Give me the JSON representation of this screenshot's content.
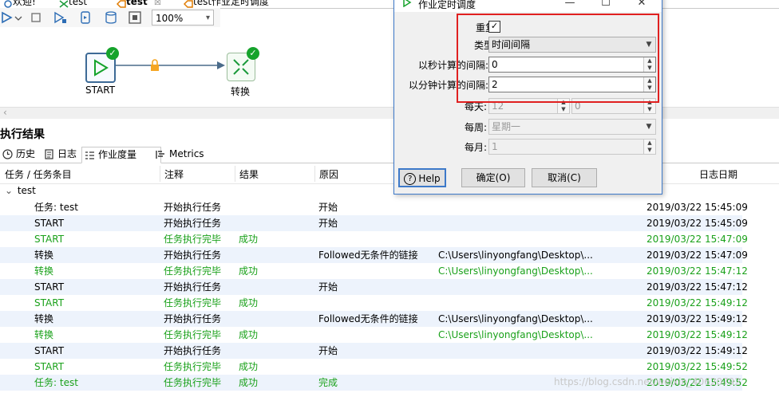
{
  "tabs": [
    {
      "label": "欢迎!",
      "active": false
    },
    {
      "label": "test",
      "active": false
    },
    {
      "label": "test",
      "active": true,
      "close": "☒"
    },
    {
      "label": "test作业定时调度",
      "active": false
    }
  ],
  "toolbar": {
    "zoom": "100%"
  },
  "canvas": {
    "start_label": "START",
    "transform_label": "转换"
  },
  "results": {
    "title": "执行结果",
    "subtabs": [
      "历史",
      "日志",
      "作业度量",
      "Metrics"
    ],
    "columns": {
      "task": "任务 / 任务条目",
      "comment": "注释",
      "result": "结果",
      "reason": "原因",
      "date": "日志日期"
    },
    "group": "test",
    "rows": [
      {
        "task": "任务: test",
        "comment": "开始执行任务",
        "result": "",
        "reason": "开始",
        "file": "",
        "date": "2019/03/22 15:45:09",
        "green": false
      },
      {
        "task": "START",
        "comment": "开始执行任务",
        "result": "",
        "reason": "开始",
        "file": "",
        "date": "2019/03/22 15:45:09",
        "green": false
      },
      {
        "task": "START",
        "comment": "任务执行完毕",
        "result": "成功",
        "reason": "",
        "file": "",
        "date": "2019/03/22 15:47:09",
        "green": true
      },
      {
        "task": "转换",
        "comment": "开始执行任务",
        "result": "",
        "reason": "Followed无条件的链接",
        "file": "C:\\Users\\linyongfang\\Desktop\\...",
        "date": "2019/03/22 15:47:09",
        "green": false
      },
      {
        "task": "转换",
        "comment": "任务执行完毕",
        "result": "成功",
        "reason": "",
        "file": "C:\\Users\\linyongfang\\Desktop\\...",
        "date": "2019/03/22 15:47:12",
        "green": true
      },
      {
        "task": "START",
        "comment": "开始执行任务",
        "result": "",
        "reason": "开始",
        "file": "",
        "date": "2019/03/22 15:47:12",
        "green": false
      },
      {
        "task": "START",
        "comment": "任务执行完毕",
        "result": "成功",
        "reason": "",
        "file": "",
        "date": "2019/03/22 15:49:12",
        "green": true
      },
      {
        "task": "转换",
        "comment": "开始执行任务",
        "result": "",
        "reason": "Followed无条件的链接",
        "file": "C:\\Users\\linyongfang\\Desktop\\...",
        "date": "2019/03/22 15:49:12",
        "green": false
      },
      {
        "task": "转换",
        "comment": "任务执行完毕",
        "result": "成功",
        "reason": "",
        "file": "C:\\Users\\linyongfang\\Desktop\\...",
        "date": "2019/03/22 15:49:12",
        "green": true
      },
      {
        "task": "START",
        "comment": "开始执行任务",
        "result": "",
        "reason": "开始",
        "file": "",
        "date": "2019/03/22 15:49:12",
        "green": false
      },
      {
        "task": "START",
        "comment": "任务执行完毕",
        "result": "成功",
        "reason": "",
        "file": "",
        "date": "2019/03/22 15:49:52",
        "green": true
      },
      {
        "task": "任务: test",
        "comment": "任务执行完毕",
        "result": "成功",
        "reason": "完成",
        "file": "",
        "date": "2019/03/22 15:49:52",
        "green": true
      }
    ]
  },
  "dialog": {
    "title": "作业定时调度",
    "repeat_label": "重复:",
    "repeat_checked": true,
    "type_label": "类型:",
    "type_value": "时间间隔",
    "seconds_label": "以秒计算的间隔:",
    "seconds_value": "0",
    "minutes_label": "以分钟计算的间隔:",
    "minutes_value": "2",
    "daily_label": "每天:",
    "daily_hour": "12",
    "daily_minute": "0",
    "weekly_label": "每周:",
    "weekly_value": "星期一",
    "monthly_label": "每月:",
    "monthly_value": "1",
    "help_label": "Help",
    "ok_label": "确定(O)",
    "cancel_label": "取消(C)"
  },
  "watermark": "https://blog.csdn.net/weixin_40620792",
  "colors": {
    "highlight": "#e02020",
    "success_green": "#1aa11a",
    "row_alt": "#edf3fc"
  }
}
